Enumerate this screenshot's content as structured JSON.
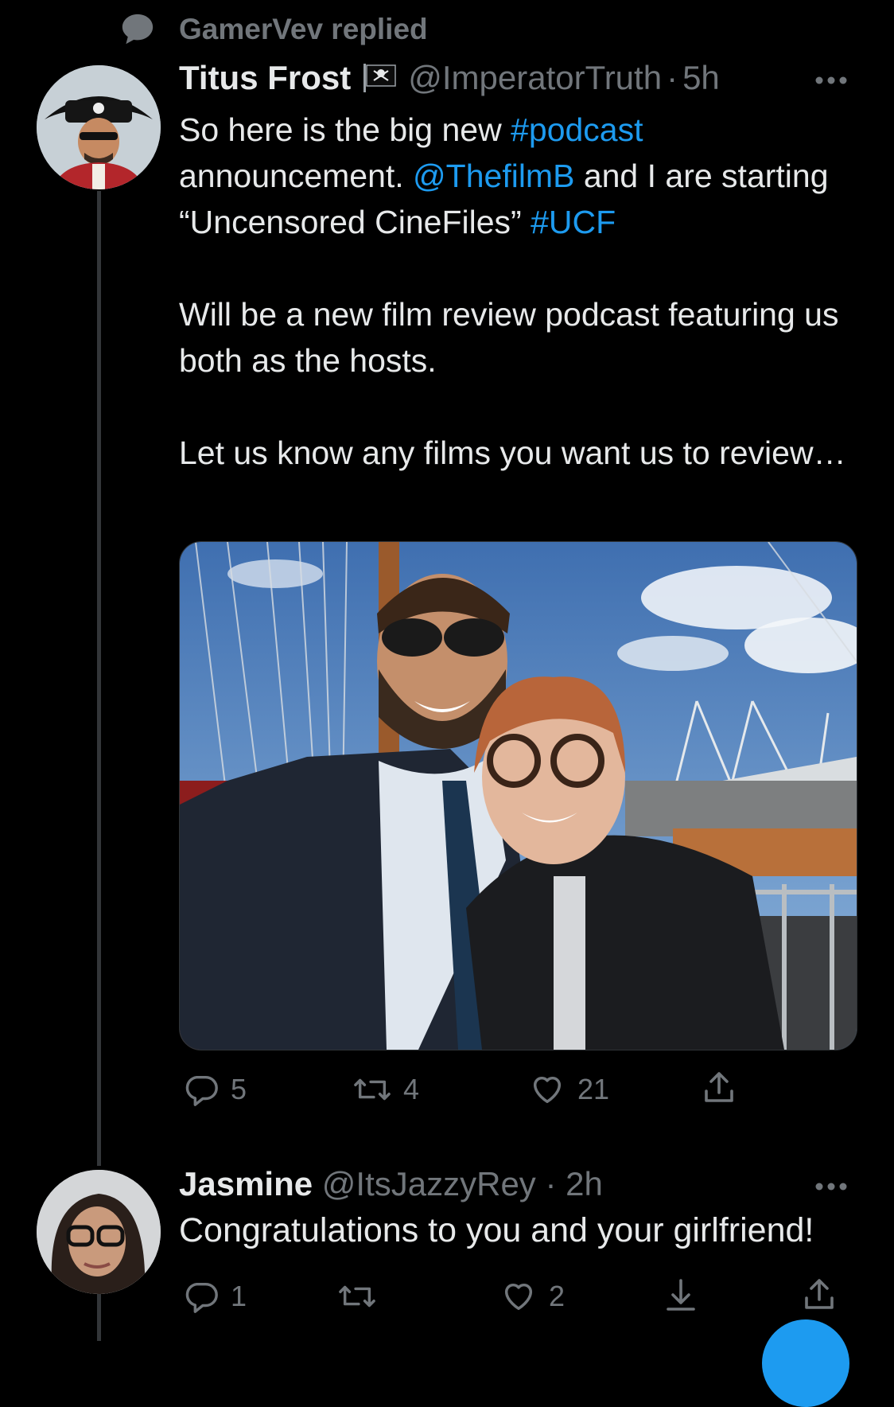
{
  "context": {
    "text": "GamerVev replied",
    "icon": "reply-bubble-icon"
  },
  "tweet": {
    "author_name": "Titus Frost",
    "handle": "@ImperatorTruth",
    "separator": "·",
    "time": "5h",
    "more_icon": "more-icon",
    "text": {
      "p1_a": "So here is the big new ",
      "p1_hashtag1": "#podcast",
      "p1_b": " announcement. ",
      "p1_mention": "@ThefilmB",
      "p1_c": " and I are starting “Uncensored CineFiles” ",
      "p1_hashtag2": "#UCF",
      "p2": "Will be a new film review podcast featuring us both as the hosts.",
      "p3": "Let us know any films you want us to review…"
    },
    "actions": {
      "replies": "5",
      "retweets": "4",
      "likes": "21"
    }
  },
  "reply": {
    "author_name": "Jasmine",
    "handle": "@ItsJazzyRey",
    "separator": "·",
    "time": "2h",
    "text": "Congratulations to you and your girlfriend!",
    "actions": {
      "replies": "1",
      "retweets": "",
      "likes": "2"
    }
  },
  "colors": {
    "background": "#000000",
    "text": "#e7e9ea",
    "muted": "#71767b",
    "link": "#1d9bf0"
  }
}
